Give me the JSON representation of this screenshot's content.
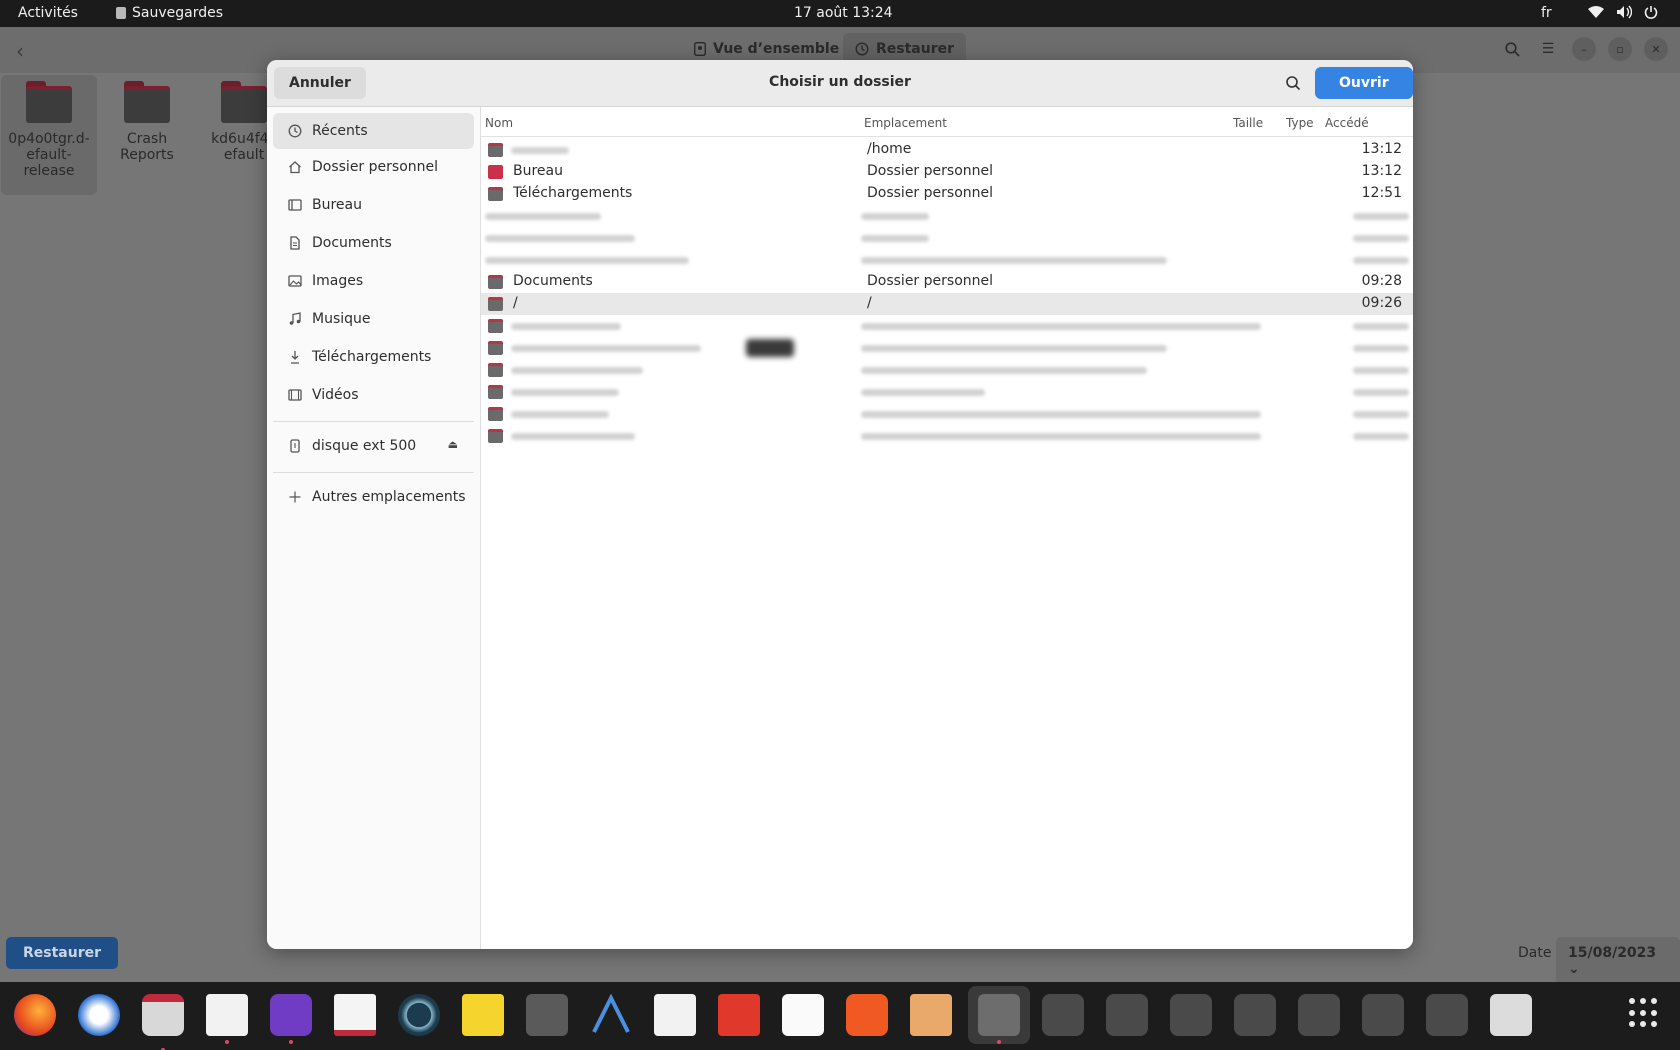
{
  "topbar": {
    "activities": "Activités",
    "app_name": "Sauvegardes",
    "clock": "17 août  13:24",
    "lang": "fr"
  },
  "background": {
    "tabs": [
      "Vue d’ensemble",
      "Restaurer"
    ],
    "folders": [
      {
        "label": "0p4o0tgr.d-\nefault-\nrelease",
        "l1": "0p4o0tgr.d-",
        "l2": "efault-",
        "l3": "release"
      },
      {
        "l1": "Crash",
        "l2": "Reports",
        "l3": ""
      },
      {
        "l1": "kd6u4f4l.",
        "l2": "efault",
        "l3": ""
      }
    ],
    "restore_button": "Restaurer",
    "date_label": "Date",
    "date_value": "15/08/2023"
  },
  "dialog": {
    "title": "Choisir un dossier",
    "cancel": "Annuler",
    "open": "Ouvrir",
    "accent": "#3584e4",
    "sidebar": [
      {
        "label": "Récents",
        "icon": "clock-icon"
      },
      {
        "label": "Dossier personnel",
        "icon": "home-icon"
      },
      {
        "label": "Bureau",
        "icon": "desktop-icon"
      },
      {
        "label": "Documents",
        "icon": "document-icon"
      },
      {
        "label": "Images",
        "icon": "image-icon"
      },
      {
        "label": "Musique",
        "icon": "music-icon"
      },
      {
        "label": "Téléchargements",
        "icon": "download-icon"
      },
      {
        "label": "Vidéos",
        "icon": "video-icon"
      },
      {
        "label": "disque ext 500",
        "icon": "usb-drive-icon"
      },
      {
        "label": "Autres emplacements",
        "icon": "plus-icon"
      }
    ],
    "columns": {
      "name": "Nom",
      "location": "Emplacement",
      "size": "Taille",
      "type": "Type",
      "accessed": "Accédé"
    },
    "rows": [
      {
        "name": "",
        "location": "/home",
        "time": "13:12"
      },
      {
        "name": "Bureau",
        "location": "Dossier personnel",
        "time": "13:12"
      },
      {
        "name": "Téléchargements",
        "location": "Dossier personnel",
        "time": "12:51"
      },
      {
        "name": "Documents",
        "location": "Dossier personnel",
        "time": "09:28"
      },
      {
        "name": "/",
        "location": "/",
        "time": "09:26"
      }
    ]
  }
}
